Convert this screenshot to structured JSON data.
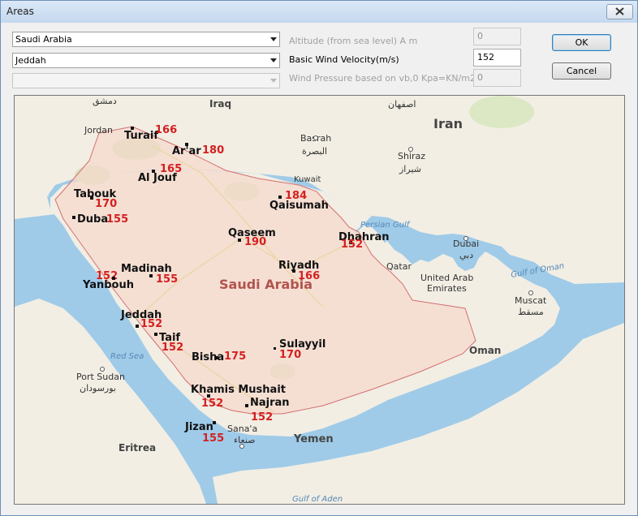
{
  "window": {
    "title": "Areas"
  },
  "controls": {
    "country_value": "Saudi Arabia",
    "city_value": "Jeddah",
    "third_value": "",
    "altitude_label": "Altitude (from sea level) A m",
    "altitude_value": "0",
    "wind_velocity_label": "Basic Wind Velocity(m/s)",
    "wind_velocity_value": "152",
    "wind_pressure_label": "Wind Pressure based on vb,0 Kpa=KN/m2",
    "wind_pressure_value": "0",
    "ok_label": "OK",
    "cancel_label": "Cancel"
  },
  "map": {
    "country_label": "Saudi Arabia",
    "region_labels": {
      "iraq": "Iraq",
      "iran": "Iran",
      "jordan": "Jordan",
      "kuwait": "Kuwait",
      "qatar": "Qatar",
      "uae_1": "United Arab",
      "uae_2": "Emirates",
      "oman": "Oman",
      "yemen": "Yemen",
      "eritrea": "Eritrea"
    },
    "water_labels": {
      "persian_gulf": "Persian Gulf",
      "gulf_of_oman": "Gulf of Oman",
      "red_sea": "Red Sea",
      "gulf_of_aden": "Gulf of Aden"
    },
    "foreign_cities": {
      "damascus_ar": "دمشق",
      "isfahan_ar": "اصفهان",
      "basrah": "Basrah",
      "basrah_ar": "البصرة",
      "shiraz": "Shiraz",
      "shiraz_ar": "شيراز",
      "dubai": "Dubai",
      "dubai_ar": "دبي",
      "muscat": "Muscat",
      "muscat_ar": "مسقط",
      "port_sudan": "Port Sudan",
      "port_sudan_ar": "بورسودان",
      "sanaa": "Sana'a",
      "sanaa_ar": "صنعاء"
    },
    "cities": [
      {
        "name": "Turaif",
        "value": "166"
      },
      {
        "name": "Ar'ar",
        "value": "180"
      },
      {
        "name": "Al Jouf",
        "value": "165"
      },
      {
        "name": "Tabouk",
        "value": "170"
      },
      {
        "name": "Duba",
        "value": "155"
      },
      {
        "name": "Qaisumah",
        "value": "184"
      },
      {
        "name": "Qaseem",
        "value": "190"
      },
      {
        "name": "Dhahran",
        "value": "152"
      },
      {
        "name": "Riyadh",
        "value": "166"
      },
      {
        "name": "Madinah",
        "value": "155"
      },
      {
        "name": "Yanbouh",
        "value": "152"
      },
      {
        "name": "Jeddah",
        "value": "152"
      },
      {
        "name": "Taif",
        "value": "152"
      },
      {
        "name": "Bisha",
        "value": "175"
      },
      {
        "name": "Sulayyil",
        "value": "170"
      },
      {
        "name": "Khamis Mushait",
        "value": "152"
      },
      {
        "name": "Najran",
        "value": "152"
      },
      {
        "name": "Jizan",
        "value": "155"
      }
    ]
  }
}
